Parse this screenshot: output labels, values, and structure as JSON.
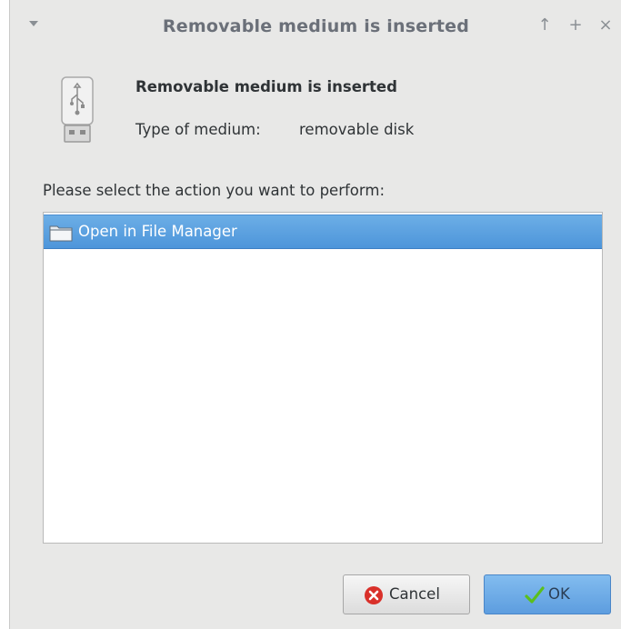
{
  "window": {
    "title": "Removable medium is inserted",
    "buttons": {
      "shade": "↑",
      "maximize": "+",
      "close": "×"
    }
  },
  "info": {
    "heading": "Removable medium is inserted",
    "type_label": "Type of medium:",
    "type_value": "removable disk"
  },
  "prompt": "Please select the action you want to perform:",
  "actions": [
    {
      "label": "Open in File Manager",
      "icon": "folder-icon",
      "selected": true
    }
  ],
  "buttons": {
    "cancel": {
      "label": "Cancel",
      "icon": "cancel-icon"
    },
    "ok": {
      "label": "OK",
      "icon": "checkmark-icon"
    }
  },
  "colors": {
    "selection": "#4d95da",
    "ok_button": "#6fa9e6",
    "cancel_icon": "#d9302a",
    "check_icon": "#5bbf1c"
  }
}
